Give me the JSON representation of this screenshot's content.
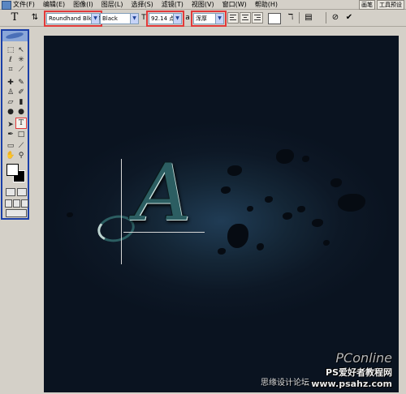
{
  "menu": {
    "items": [
      "文件(F)",
      "编辑(E)",
      "图像(I)",
      "图层(L)",
      "选择(S)",
      "滤镜(T)",
      "视图(V)",
      "窗口(W)",
      "帮助(H)"
    ],
    "tabs": [
      "画笔",
      "工具预设"
    ]
  },
  "options": {
    "font_family": "Roundhand Blk BT",
    "font_style": "Black",
    "font_size": "92.14 点",
    "anti_alias": "浑厚",
    "highlight_color": "#e23a3a"
  },
  "toolbox": {
    "active_tool": "type-tool",
    "tools": [
      "marquee",
      "move",
      "lasso",
      "magic-wand",
      "crop",
      "slice",
      "healing",
      "brush",
      "stamp",
      "history-brush",
      "eraser",
      "gradient",
      "blur",
      "dodge",
      "path-select",
      "type",
      "pen",
      "shape",
      "notes",
      "eyedropper",
      "hand",
      "zoom"
    ],
    "foreground_color": "#ffffff",
    "background_color": "#000000"
  },
  "canvas": {
    "letter": "A",
    "letter_color": "#2c5e62",
    "background_color": "#0d1826"
  },
  "watermark": {
    "logo": "PConline",
    "site": "PS爱好者教程网",
    "url": "www.psahz.com",
    "caption": "思缘设计论坛"
  }
}
